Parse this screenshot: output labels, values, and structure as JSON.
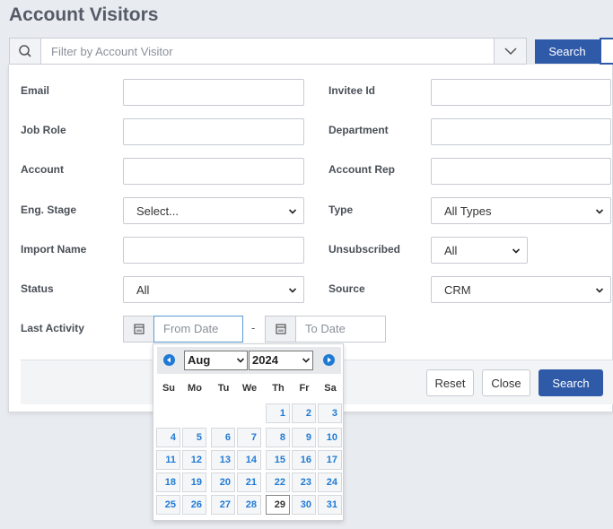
{
  "page": {
    "title": "Account Visitors"
  },
  "search": {
    "placeholder": "Filter by Account Visitor",
    "button_label": "Search"
  },
  "filters": {
    "email_label": "Email",
    "invitee_label": "Invitee Id",
    "jobrole_label": "Job Role",
    "department_label": "Department",
    "account_label": "Account",
    "accountrep_label": "Account Rep",
    "engstage_label": "Eng. Stage",
    "engstage_value": "Select...",
    "type_label": "Type",
    "type_value": "All Types",
    "importname_label": "Import Name",
    "unsubscribed_label": "Unsubscribed",
    "unsubscribed_value": "All",
    "status_label": "Status",
    "status_value": "All",
    "source_label": "Source",
    "source_value": "CRM",
    "lastactivity_label": "Last Activity",
    "from_placeholder": "From Date",
    "to_placeholder": "To Date",
    "range_separator": "-"
  },
  "footer": {
    "reset_label": "Reset",
    "close_label": "Close",
    "search_label": "Search"
  },
  "datepicker": {
    "month": "Aug",
    "year": "2024",
    "weekdays": [
      "Su",
      "Mo",
      "Tu",
      "We",
      "Th",
      "Fr",
      "Sa"
    ],
    "days": [
      "1",
      "2",
      "3",
      "4",
      "5",
      "6",
      "7",
      "8",
      "9",
      "10",
      "11",
      "12",
      "13",
      "14",
      "15",
      "16",
      "17",
      "18",
      "19",
      "20",
      "21",
      "22",
      "23",
      "24",
      "25",
      "26",
      "27",
      "28",
      "29",
      "30",
      "31"
    ],
    "first_weekday": 4,
    "today": "29"
  },
  "colors": {
    "primary": "#2f5aa8",
    "link_blue": "#1f7ad6"
  }
}
